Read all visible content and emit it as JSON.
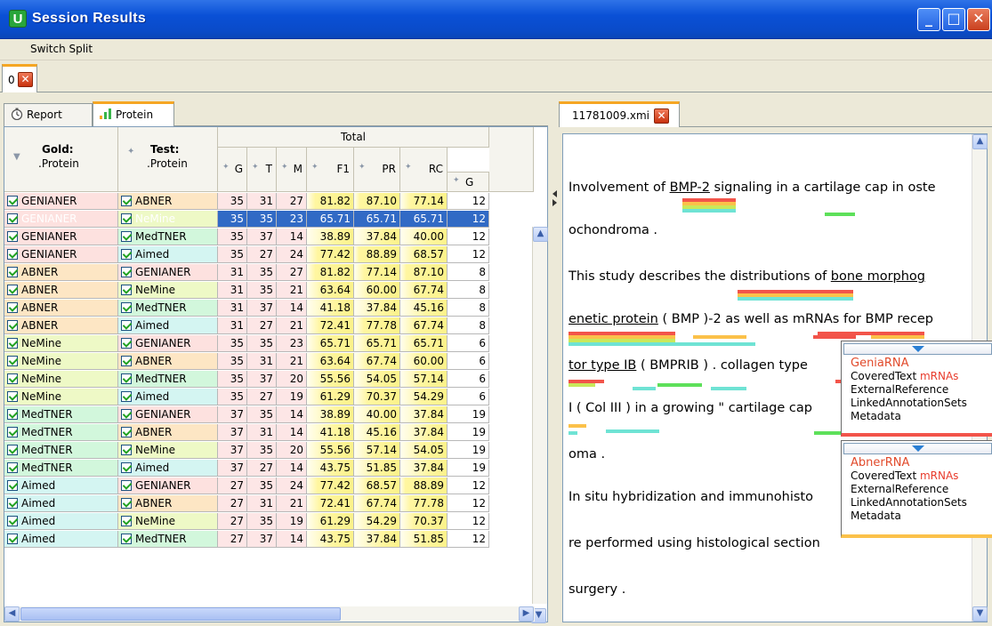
{
  "window": {
    "title": "Session Results",
    "app_icon": "U",
    "buttons": {
      "minimize": "_",
      "maximize": "□",
      "close": "✕"
    }
  },
  "menu": {
    "switch_split": "Switch Split"
  },
  "outer_tab": {
    "label": "0"
  },
  "left": {
    "tabs": [
      {
        "label": "Report",
        "icon": "stopwatch-icon"
      },
      {
        "label": "Protein",
        "icon": "bar-chart-icon"
      }
    ],
    "headers": {
      "gold_title": "Gold:",
      "gold_sub": ".Protein",
      "test_title": "Test:",
      "test_sub": ".Protein",
      "total": "Total",
      "g": "G",
      "t": "T",
      "m": "M",
      "f1": "F1",
      "pr": "PR",
      "rc": "RC",
      "g2": "G"
    },
    "rows": [
      {
        "gold": "GENIANER",
        "test": "ABNER",
        "g": "35",
        "t": "31",
        "m": "27",
        "f1": "81.82",
        "pr": "87.10",
        "rc": "77.14",
        "g2": "12"
      },
      {
        "gold": "GENIANER",
        "test": "NeMine",
        "g": "35",
        "t": "35",
        "m": "23",
        "f1": "65.71",
        "pr": "65.71",
        "rc": "65.71",
        "g2": "12"
      },
      {
        "gold": "GENIANER",
        "test": "MedTNER",
        "g": "35",
        "t": "37",
        "m": "14",
        "f1": "38.89",
        "pr": "37.84",
        "rc": "40.00",
        "g2": "12"
      },
      {
        "gold": "GENIANER",
        "test": "Aimed",
        "g": "35",
        "t": "27",
        "m": "24",
        "f1": "77.42",
        "pr": "88.89",
        "rc": "68.57",
        "g2": "12"
      },
      {
        "gold": "ABNER",
        "test": "GENIANER",
        "g": "31",
        "t": "35",
        "m": "27",
        "f1": "81.82",
        "pr": "77.14",
        "rc": "87.10",
        "g2": "8"
      },
      {
        "gold": "ABNER",
        "test": "NeMine",
        "g": "31",
        "t": "35",
        "m": "21",
        "f1": "63.64",
        "pr": "60.00",
        "rc": "67.74",
        "g2": "8"
      },
      {
        "gold": "ABNER",
        "test": "MedTNER",
        "g": "31",
        "t": "37",
        "m": "14",
        "f1": "41.18",
        "pr": "37.84",
        "rc": "45.16",
        "g2": "8"
      },
      {
        "gold": "ABNER",
        "test": "Aimed",
        "g": "31",
        "t": "27",
        "m": "21",
        "f1": "72.41",
        "pr": "77.78",
        "rc": "67.74",
        "g2": "8"
      },
      {
        "gold": "NeMine",
        "test": "GENIANER",
        "g": "35",
        "t": "35",
        "m": "23",
        "f1": "65.71",
        "pr": "65.71",
        "rc": "65.71",
        "g2": "6"
      },
      {
        "gold": "NeMine",
        "test": "ABNER",
        "g": "35",
        "t": "31",
        "m": "21",
        "f1": "63.64",
        "pr": "67.74",
        "rc": "60.00",
        "g2": "6"
      },
      {
        "gold": "NeMine",
        "test": "MedTNER",
        "g": "35",
        "t": "37",
        "m": "20",
        "f1": "55.56",
        "pr": "54.05",
        "rc": "57.14",
        "g2": "6"
      },
      {
        "gold": "NeMine",
        "test": "Aimed",
        "g": "35",
        "t": "27",
        "m": "19",
        "f1": "61.29",
        "pr": "70.37",
        "rc": "54.29",
        "g2": "6"
      },
      {
        "gold": "MedTNER",
        "test": "GENIANER",
        "g": "37",
        "t": "35",
        "m": "14",
        "f1": "38.89",
        "pr": "40.00",
        "rc": "37.84",
        "g2": "19"
      },
      {
        "gold": "MedTNER",
        "test": "ABNER",
        "g": "37",
        "t": "31",
        "m": "14",
        "f1": "41.18",
        "pr": "45.16",
        "rc": "37.84",
        "g2": "19"
      },
      {
        "gold": "MedTNER",
        "test": "NeMine",
        "g": "37",
        "t": "35",
        "m": "20",
        "f1": "55.56",
        "pr": "57.14",
        "rc": "54.05",
        "g2": "19"
      },
      {
        "gold": "MedTNER",
        "test": "Aimed",
        "g": "37",
        "t": "27",
        "m": "14",
        "f1": "43.75",
        "pr": "51.85",
        "rc": "37.84",
        "g2": "19"
      },
      {
        "gold": "Aimed",
        "test": "GENIANER",
        "g": "27",
        "t": "35",
        "m": "24",
        "f1": "77.42",
        "pr": "68.57",
        "rc": "88.89",
        "g2": "12"
      },
      {
        "gold": "Aimed",
        "test": "ABNER",
        "g": "27",
        "t": "31",
        "m": "21",
        "f1": "72.41",
        "pr": "67.74",
        "rc": "77.78",
        "g2": "12"
      },
      {
        "gold": "Aimed",
        "test": "NeMine",
        "g": "27",
        "t": "35",
        "m": "19",
        "f1": "61.29",
        "pr": "54.29",
        "rc": "70.37",
        "g2": "12"
      },
      {
        "gold": "Aimed",
        "test": "MedTNER",
        "g": "27",
        "t": "37",
        "m": "14",
        "f1": "43.75",
        "pr": "37.84",
        "rc": "51.85",
        "g2": "12"
      }
    ],
    "name_colors": {
      "GENIANER": "#fde1df",
      "ABNER": "#fde6c4",
      "NeMine": "#eef9c6",
      "MedTNER": "#d2f7dc",
      "Aimed": "#d4f5f2"
    },
    "selected_row": 1
  },
  "right": {
    "doc_tab": {
      "label": "11781009.xmi"
    },
    "lines": [
      {
        "pre": "Involvement of ",
        "u": "BMP-2",
        "post": " signaling in a cartilage cap in oste"
      },
      {
        "pre": "ochondroma .",
        "u": "",
        "post": ""
      },
      {
        "pre": "This study describes the distributions of ",
        "u": "bone morphog",
        "post": ""
      },
      {
        "pre": "",
        "u": "enetic protein",
        "post": " ( BMP )-2 as well as mRNAs for BMP recep"
      },
      {
        "pre": "",
        "u": "tor type IB",
        "post": " ( BMPRIB ) . collagen type"
      },
      {
        "pre": "I ( Col III ) in a growing \" cartilage cap",
        "u": "",
        "post": ""
      },
      {
        "pre": "oma .",
        "u": "",
        "post": ""
      },
      {
        "pre": "In situ hybridization and immunohisto",
        "u": "",
        "post": ""
      },
      {
        "pre": "re performed using histological section",
        "u": "",
        "post": ""
      },
      {
        "pre": " surgery .",
        "u": "",
        "post": ""
      }
    ],
    "popup1": {
      "title": "GeniaRNA",
      "lines": [
        {
          "label": "CoveredText ",
          "val": "mRNAs"
        },
        {
          "label": "ExternalReference",
          "val": ""
        },
        {
          "label": "LinkedAnnotationSets",
          "val": ""
        },
        {
          "label": "Metadata",
          "val": ""
        }
      ]
    },
    "popup2": {
      "title": "AbnerRNA",
      "lines": [
        {
          "label": "CoveredText ",
          "val": "mRNAs"
        },
        {
          "label": "ExternalReference",
          "val": ""
        },
        {
          "label": "LinkedAnnotationSets",
          "val": ""
        },
        {
          "label": "Metadata",
          "val": ""
        }
      ]
    },
    "annotation_colors": {
      "red": "#f2544a",
      "orange": "#fbc14a",
      "green": "#5de05a",
      "cyan": "#6fe3d4",
      "yellowgreen": "#c9e85b"
    }
  }
}
